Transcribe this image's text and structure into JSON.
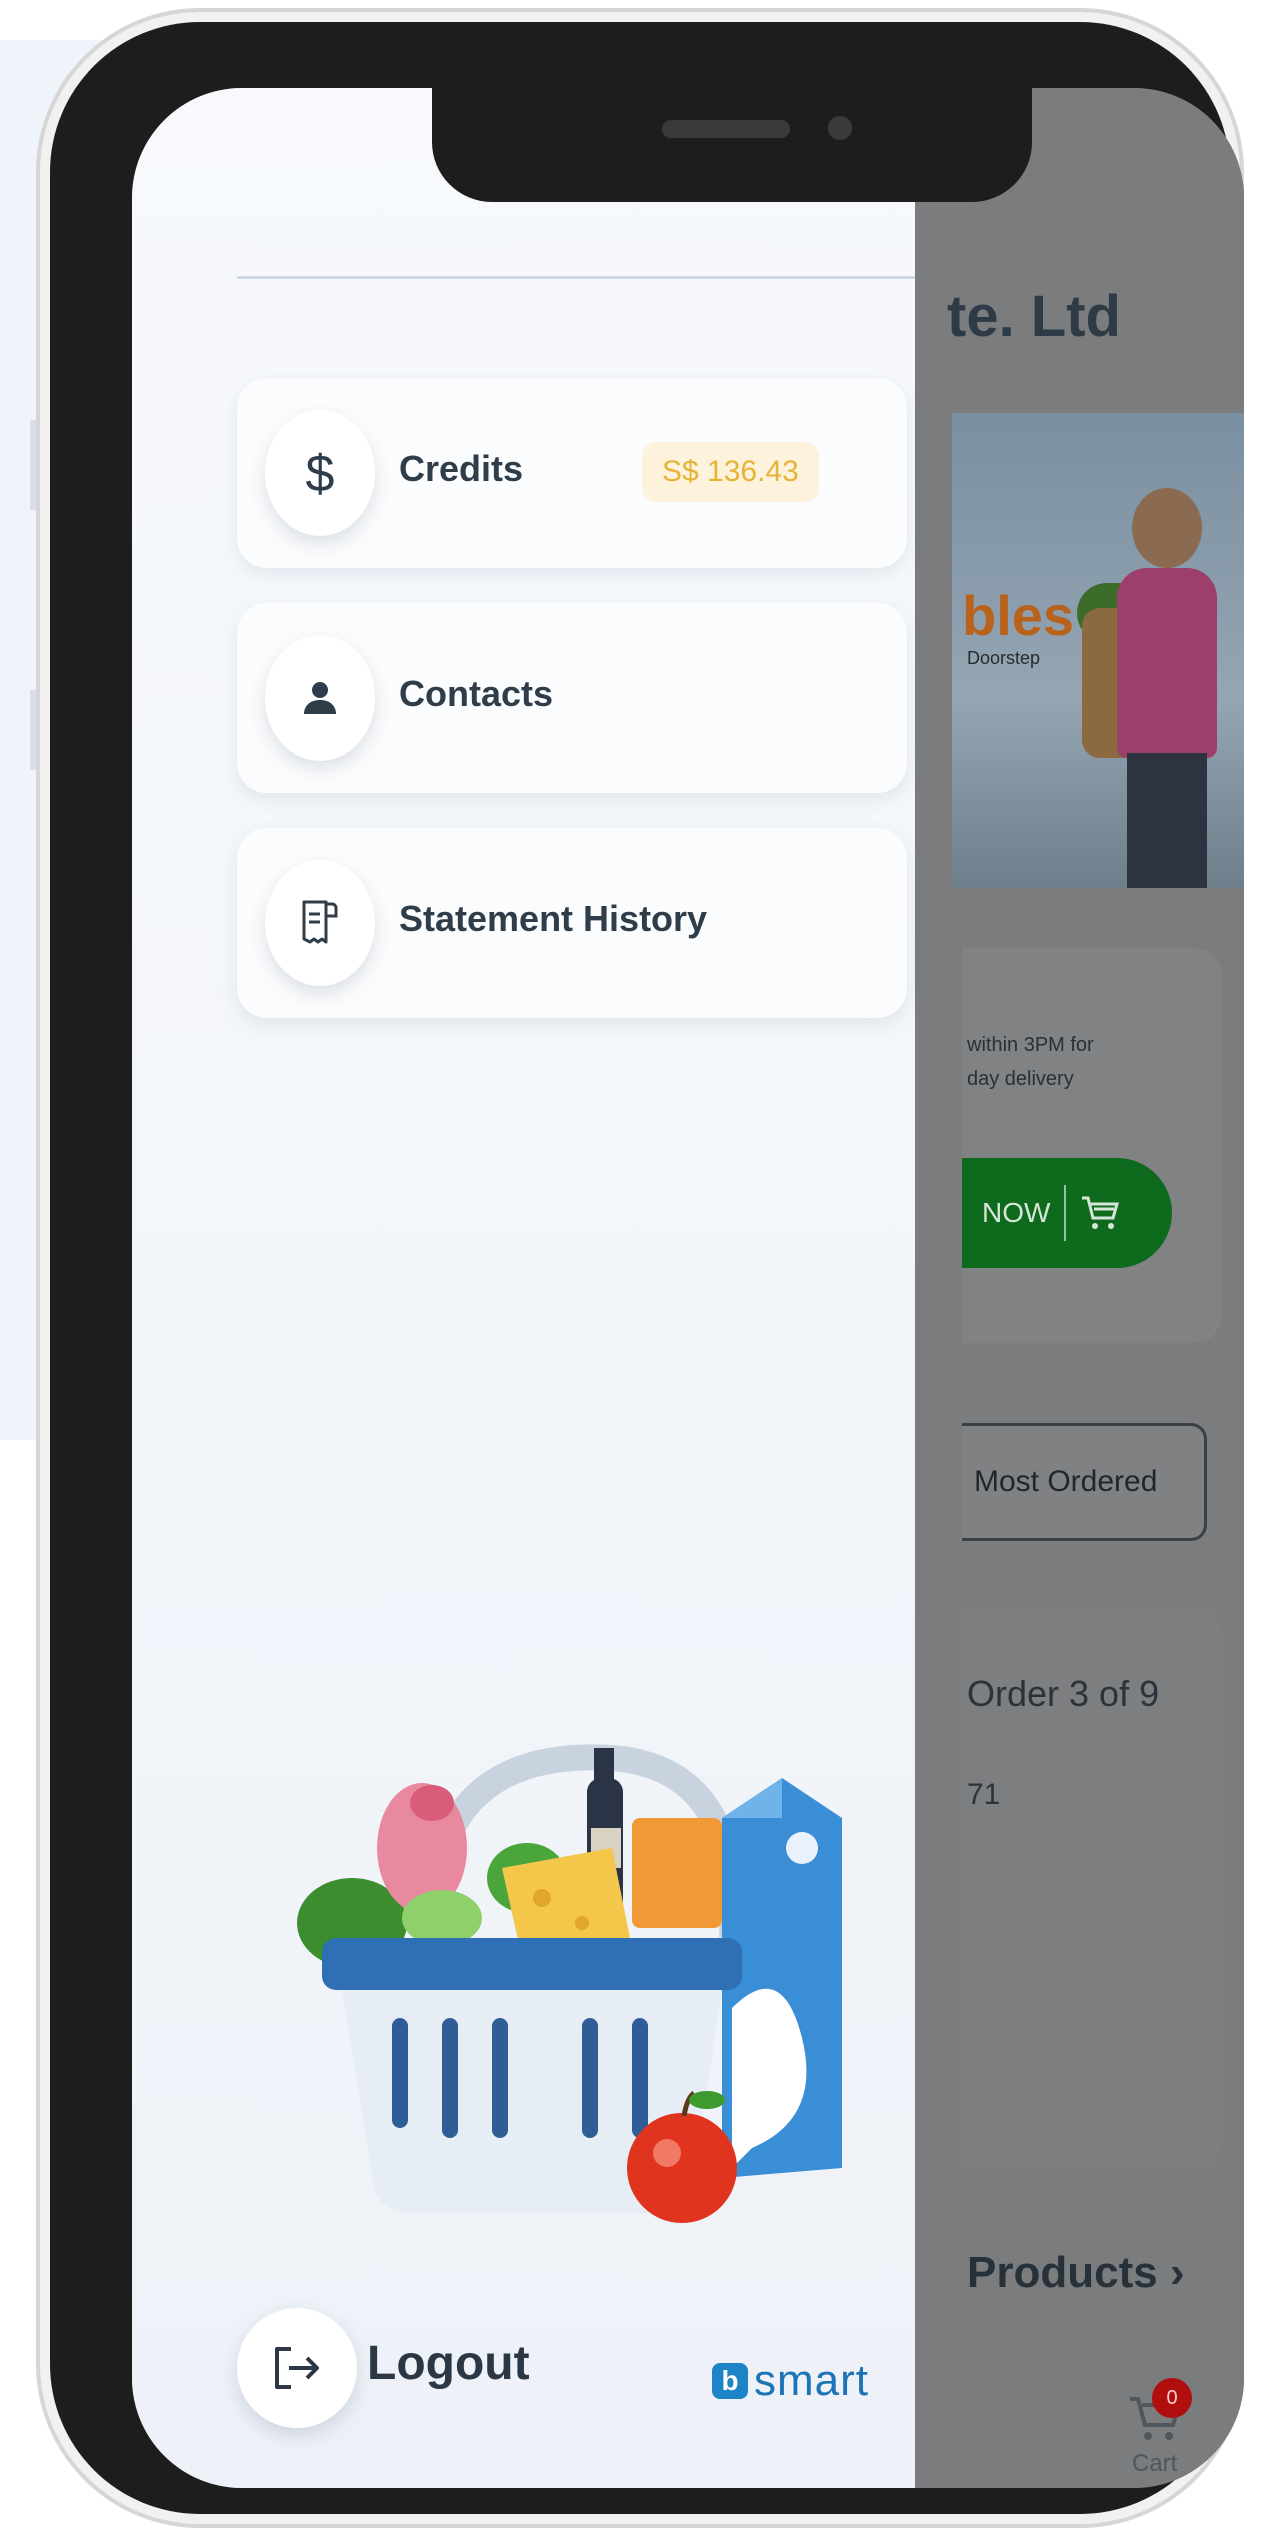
{
  "app": {
    "title_fragment": "te. Ltd",
    "banner": {
      "headline_fragment": "bles",
      "tagline_fragment": "Doorstep"
    },
    "order_card": {
      "note": "within 3PM for\nday delivery",
      "button_label": "NOW"
    },
    "most_ordered_label": "Most Ordered",
    "order_count_text": "Order 3  of 9",
    "order_number_fragment": "71",
    "products_link_label": "Products",
    "cart": {
      "badge_count": "0",
      "label": "Cart"
    }
  },
  "drawer": {
    "menu_items": [
      {
        "icon": "dollar-icon",
        "label": "Credits",
        "badge": "S$ 136.43"
      },
      {
        "icon": "contact-person-icon",
        "label": "Contacts"
      },
      {
        "icon": "receipt-icon",
        "label": "Statement History"
      }
    ],
    "logout_label": "Logout",
    "brand": {
      "mark": "b",
      "name": "smart"
    }
  },
  "colors": {
    "accent_green": "#0e6a1d",
    "credit_badge_text": "#e7b336",
    "credit_badge_bg": "#fdf3dc",
    "brand_blue": "#1b74b6",
    "cart_badge": "#b10e0e"
  }
}
